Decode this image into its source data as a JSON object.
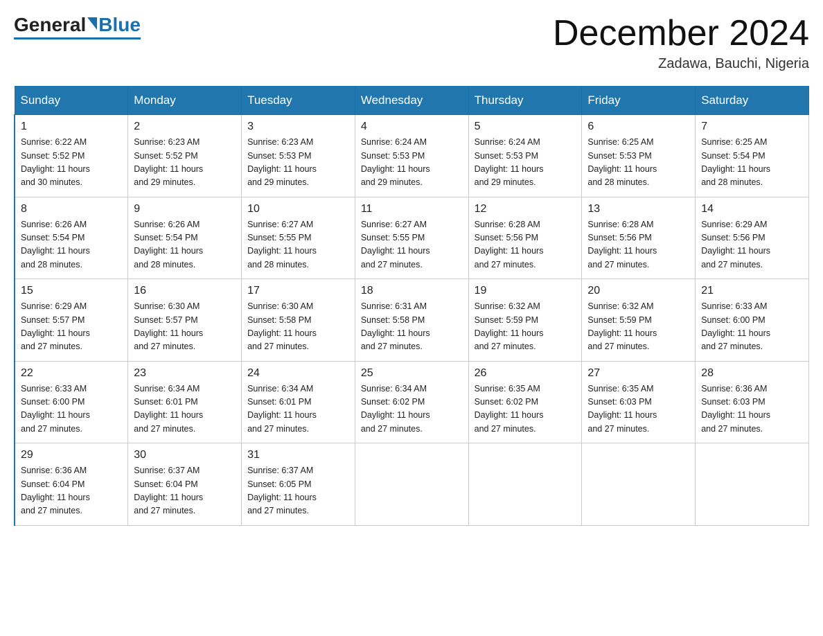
{
  "header": {
    "logo_general": "General",
    "logo_blue": "Blue",
    "month_title": "December 2024",
    "location": "Zadawa, Bauchi, Nigeria"
  },
  "days_of_week": [
    "Sunday",
    "Monday",
    "Tuesday",
    "Wednesday",
    "Thursday",
    "Friday",
    "Saturday"
  ],
  "weeks": [
    [
      {
        "day": "1",
        "sunrise": "6:22 AM",
        "sunset": "5:52 PM",
        "daylight": "11 hours and 30 minutes."
      },
      {
        "day": "2",
        "sunrise": "6:23 AM",
        "sunset": "5:52 PM",
        "daylight": "11 hours and 29 minutes."
      },
      {
        "day": "3",
        "sunrise": "6:23 AM",
        "sunset": "5:53 PM",
        "daylight": "11 hours and 29 minutes."
      },
      {
        "day": "4",
        "sunrise": "6:24 AM",
        "sunset": "5:53 PM",
        "daylight": "11 hours and 29 minutes."
      },
      {
        "day": "5",
        "sunrise": "6:24 AM",
        "sunset": "5:53 PM",
        "daylight": "11 hours and 29 minutes."
      },
      {
        "day": "6",
        "sunrise": "6:25 AM",
        "sunset": "5:53 PM",
        "daylight": "11 hours and 28 minutes."
      },
      {
        "day": "7",
        "sunrise": "6:25 AM",
        "sunset": "5:54 PM",
        "daylight": "11 hours and 28 minutes."
      }
    ],
    [
      {
        "day": "8",
        "sunrise": "6:26 AM",
        "sunset": "5:54 PM",
        "daylight": "11 hours and 28 minutes."
      },
      {
        "day": "9",
        "sunrise": "6:26 AM",
        "sunset": "5:54 PM",
        "daylight": "11 hours and 28 minutes."
      },
      {
        "day": "10",
        "sunrise": "6:27 AM",
        "sunset": "5:55 PM",
        "daylight": "11 hours and 28 minutes."
      },
      {
        "day": "11",
        "sunrise": "6:27 AM",
        "sunset": "5:55 PM",
        "daylight": "11 hours and 27 minutes."
      },
      {
        "day": "12",
        "sunrise": "6:28 AM",
        "sunset": "5:56 PM",
        "daylight": "11 hours and 27 minutes."
      },
      {
        "day": "13",
        "sunrise": "6:28 AM",
        "sunset": "5:56 PM",
        "daylight": "11 hours and 27 minutes."
      },
      {
        "day": "14",
        "sunrise": "6:29 AM",
        "sunset": "5:56 PM",
        "daylight": "11 hours and 27 minutes."
      }
    ],
    [
      {
        "day": "15",
        "sunrise": "6:29 AM",
        "sunset": "5:57 PM",
        "daylight": "11 hours and 27 minutes."
      },
      {
        "day": "16",
        "sunrise": "6:30 AM",
        "sunset": "5:57 PM",
        "daylight": "11 hours and 27 minutes."
      },
      {
        "day": "17",
        "sunrise": "6:30 AM",
        "sunset": "5:58 PM",
        "daylight": "11 hours and 27 minutes."
      },
      {
        "day": "18",
        "sunrise": "6:31 AM",
        "sunset": "5:58 PM",
        "daylight": "11 hours and 27 minutes."
      },
      {
        "day": "19",
        "sunrise": "6:32 AM",
        "sunset": "5:59 PM",
        "daylight": "11 hours and 27 minutes."
      },
      {
        "day": "20",
        "sunrise": "6:32 AM",
        "sunset": "5:59 PM",
        "daylight": "11 hours and 27 minutes."
      },
      {
        "day": "21",
        "sunrise": "6:33 AM",
        "sunset": "6:00 PM",
        "daylight": "11 hours and 27 minutes."
      }
    ],
    [
      {
        "day": "22",
        "sunrise": "6:33 AM",
        "sunset": "6:00 PM",
        "daylight": "11 hours and 27 minutes."
      },
      {
        "day": "23",
        "sunrise": "6:34 AM",
        "sunset": "6:01 PM",
        "daylight": "11 hours and 27 minutes."
      },
      {
        "day": "24",
        "sunrise": "6:34 AM",
        "sunset": "6:01 PM",
        "daylight": "11 hours and 27 minutes."
      },
      {
        "day": "25",
        "sunrise": "6:34 AM",
        "sunset": "6:02 PM",
        "daylight": "11 hours and 27 minutes."
      },
      {
        "day": "26",
        "sunrise": "6:35 AM",
        "sunset": "6:02 PM",
        "daylight": "11 hours and 27 minutes."
      },
      {
        "day": "27",
        "sunrise": "6:35 AM",
        "sunset": "6:03 PM",
        "daylight": "11 hours and 27 minutes."
      },
      {
        "day": "28",
        "sunrise": "6:36 AM",
        "sunset": "6:03 PM",
        "daylight": "11 hours and 27 minutes."
      }
    ],
    [
      {
        "day": "29",
        "sunrise": "6:36 AM",
        "sunset": "6:04 PM",
        "daylight": "11 hours and 27 minutes."
      },
      {
        "day": "30",
        "sunrise": "6:37 AM",
        "sunset": "6:04 PM",
        "daylight": "11 hours and 27 minutes."
      },
      {
        "day": "31",
        "sunrise": "6:37 AM",
        "sunset": "6:05 PM",
        "daylight": "11 hours and 27 minutes."
      },
      null,
      null,
      null,
      null
    ]
  ],
  "sunrise_label": "Sunrise:",
  "sunset_label": "Sunset:",
  "daylight_label": "Daylight:"
}
